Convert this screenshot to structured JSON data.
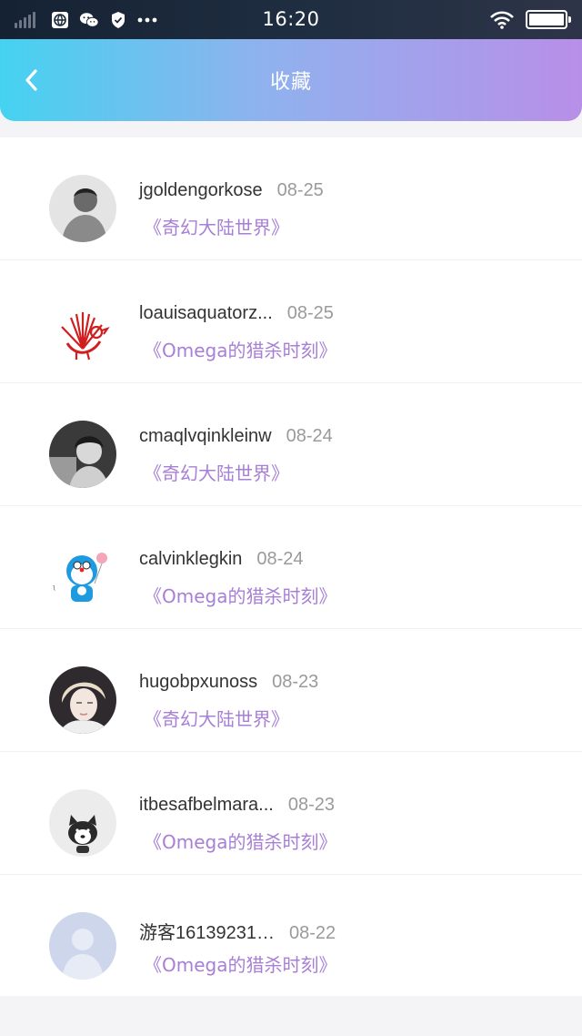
{
  "status_bar": {
    "time": "16:20",
    "icons": [
      "signal-icon",
      "globe-icon",
      "wechat-icon",
      "shield-icon",
      "more-icon",
      "wifi-icon",
      "battery-icon"
    ]
  },
  "header": {
    "title": "收藏",
    "back_icon": "chevron-left-icon"
  },
  "colors": {
    "header_gradient": [
      "#45d2f0",
      "#8fb2ee",
      "#b88fe8"
    ],
    "book_title": "#a77fd6",
    "username": "#333333",
    "date": "#9a9a9a"
  },
  "favorites": [
    {
      "username": "jgoldengorkose",
      "date": "08-25",
      "book": "《奇幻大陆世界》",
      "avatar": "avatar-boy-bw"
    },
    {
      "username": "loauisaquatorz...",
      "date": "08-25",
      "book": "《Omega的猎杀时刻》",
      "avatar": "avatar-red-rooster"
    },
    {
      "username": "cmaqlvqinkleinw",
      "date": "08-24",
      "book": "《奇幻大陆世界》",
      "avatar": "avatar-child-bw"
    },
    {
      "username": "calvinklegkin",
      "date": "08-24",
      "book": "《Omega的猎杀时刻》",
      "avatar": "avatar-doraemon"
    },
    {
      "username": "hugobpxunoss",
      "date": "08-23",
      "book": "《奇幻大陆世界》",
      "avatar": "avatar-blonde-girl"
    },
    {
      "username": "itbesafbelmara...",
      "date": "08-23",
      "book": "《Omega的猎杀时刻》",
      "avatar": "avatar-dog"
    },
    {
      "username": "游客16139231…",
      "date": "08-22",
      "book": "《Omega的猎杀时刻》",
      "avatar": "avatar-default"
    }
  ]
}
